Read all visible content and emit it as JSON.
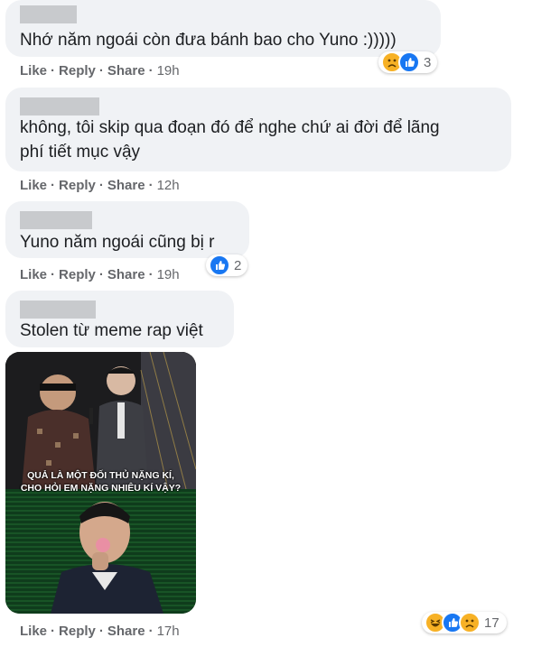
{
  "comments": [
    {
      "text_lines": [
        "Nhớ năm ngoái còn đưa bánh bao cho Yuno :)))))"
      ],
      "actions": {
        "like": "Like",
        "reply": "Reply",
        "share": "Share",
        "time": "19h"
      },
      "reactions": {
        "icons": [
          "sad-icon",
          "like-icon"
        ],
        "count": "3"
      }
    },
    {
      "text_lines": [
        "không, tôi skip qua đoạn đó để nghe chứ ai đời để lãng",
        "phí tiết mục vậy"
      ],
      "actions": {
        "like": "Like",
        "reply": "Reply",
        "share": "Share",
        "time": "12h"
      },
      "reactions": null
    },
    {
      "text_lines": [
        "Yuno năm ngoái cũng bị r"
      ],
      "actions": {
        "like": "Like",
        "reply": "Reply",
        "share": "Share",
        "time": "19h"
      },
      "reactions": {
        "icons": [
          "like-icon"
        ],
        "count": "2"
      }
    },
    {
      "text_lines": [
        "Stolen từ meme rap việt"
      ],
      "image_caption_lines": [
        "QUẢ LÀ MỘT ĐỐI THỦ NẶNG KÍ,",
        "CHO HỎI EM NẶNG NHIÊU KÍ VẬY?"
      ],
      "actions": {
        "like": "Like",
        "reply": "Reply",
        "share": "Share",
        "time": "17h"
      },
      "reactions": {
        "icons": [
          "haha-icon",
          "like-icon",
          "sad-icon"
        ],
        "count": "17"
      }
    }
  ],
  "colors": {
    "bubble": "#f0f2f5",
    "meta_text": "#65676b",
    "like_blue": "#1877f2",
    "emoji_yellow": "#f7b125"
  }
}
